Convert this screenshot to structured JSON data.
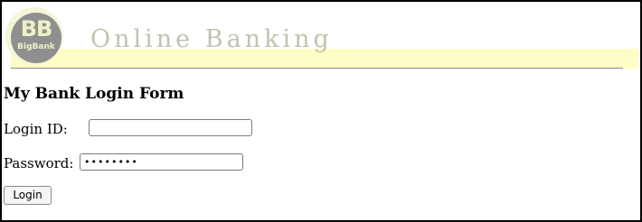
{
  "header": {
    "logo": {
      "initials": "BB",
      "name": "BigBank"
    },
    "banner_title": "Online Banking"
  },
  "form": {
    "title": "My Bank Login Form",
    "login_id_label": "Login ID:",
    "login_id_value": "",
    "password_label": "Password:",
    "password_value": "••••••••",
    "login_button_label": "Login"
  },
  "colors": {
    "banner_band": "#fdfdc6",
    "banner_title": "#c2c2b0",
    "logo_circle": "#8f8f8f",
    "logo_text": "#f0f0c8"
  }
}
